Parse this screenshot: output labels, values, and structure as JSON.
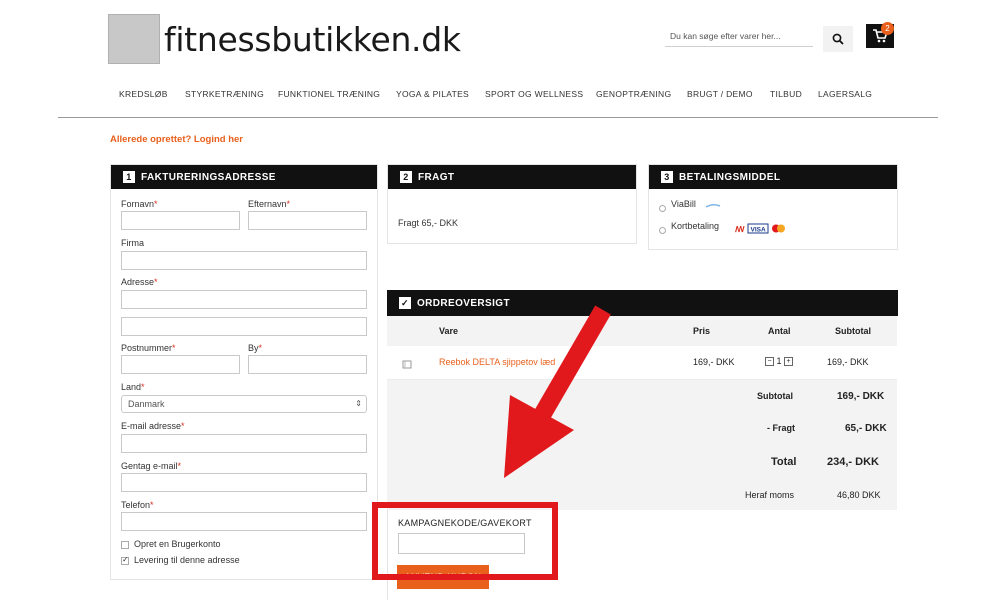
{
  "brand": {
    "name": "fitnessbutikken.dk"
  },
  "search": {
    "placeholder": "Du kan søge efter varer her..."
  },
  "cart": {
    "count": "2"
  },
  "nav": [
    "KREDSLØB",
    "STYRKETRÆNING",
    "FUNKTIONEL TRÆNING",
    "YOGA & PILATES",
    "SPORT OG WELLNESS",
    "GENOPTRÆNING",
    "BRUGT / DEMO",
    "TILBUD",
    "LAGERSALG"
  ],
  "login_link": "Allerede oprettet? Logind her",
  "billing": {
    "step": "1",
    "title": "FAKTURERINGSADRESSE",
    "firstname": "Fornavn",
    "lastname": "Efternavn",
    "company": "Firma",
    "address": "Adresse",
    "postcode": "Postnummer",
    "city": "By",
    "country_label": "Land",
    "country_value": "Danmark",
    "email": "E-mail adresse",
    "email_repeat": "Gentag e-mail",
    "phone": "Telefon",
    "required_mark": "*",
    "create_account": "Opret en Brugerkonto",
    "deliver_here": "Levering til denne adresse"
  },
  "shipping": {
    "step": "2",
    "title": "FRAGT",
    "text": "Fragt 65,- DKK"
  },
  "payment": {
    "step": "3",
    "title": "BETALINGSMIDDEL",
    "option1": "ViaBill",
    "option2": "Kortbetaling"
  },
  "order": {
    "title": "ORDREOVERSIGT",
    "headers": {
      "item": "Vare",
      "price": "Pris",
      "qty": "Antal",
      "subtotal": "Subtotal"
    },
    "row": {
      "name": "Reebok DELTA sjippetov læd",
      "price": "169,- DKK",
      "qty": "1",
      "subtotal": "169,- DKK"
    },
    "summary": {
      "subtotal_label": "Subtotal",
      "subtotal_value": "169,- DKK",
      "shipping_label": "- Fragt",
      "shipping_value": "65,- DKK",
      "total_label": "Total",
      "total_value": "234,- DKK",
      "vat_label": "Heraf moms",
      "vat_value": "46,80 DKK"
    },
    "coupon_label": "KAMPAGNEKODE/GAVEKORT",
    "apply_button": "ANVEND KUPON"
  },
  "colors": {
    "accent": "#e8601c",
    "annotation": "#e2191c",
    "header_bg": "#111111"
  }
}
